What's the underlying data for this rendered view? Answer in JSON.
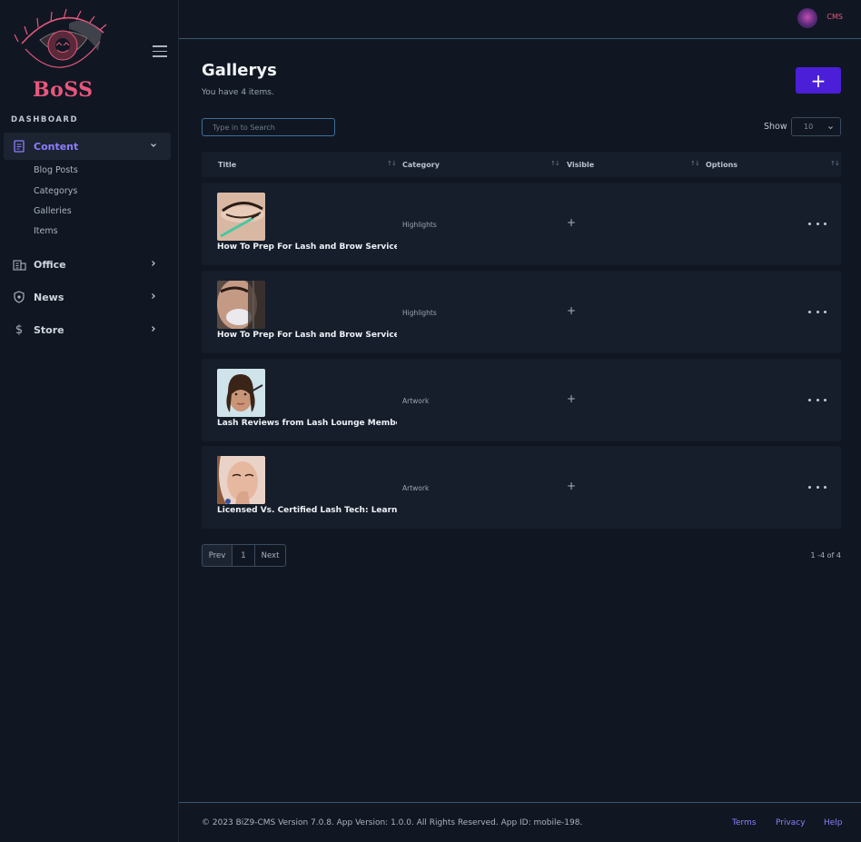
{
  "brand": {
    "logo_text": "BoSS",
    "accent": "#e8577e"
  },
  "topbar": {
    "cms_label": "CMS"
  },
  "sidebar": {
    "section_title": "DASHBOARD",
    "items": [
      {
        "label": "Content",
        "icon": "document-icon",
        "expanded": true,
        "subitems": [
          "Blog Posts",
          "Categorys",
          "Galleries",
          "Items"
        ]
      },
      {
        "label": "Office",
        "icon": "building-icon"
      },
      {
        "label": "News",
        "icon": "shield-icon"
      },
      {
        "label": "Store",
        "icon": "dollar-icon"
      }
    ]
  },
  "main": {
    "title": "Gallerys",
    "subtitle": "You have 4 items.",
    "add_button": "+",
    "search": {
      "placeholder": "Type in to Search",
      "value": ""
    },
    "show_label": "Show",
    "page_size": "10",
    "table": {
      "headers": [
        "Title",
        "Category",
        "Visible",
        "Options"
      ],
      "rows": [
        {
          "title": "How To Prep For Lash and Brow Services",
          "category": "Highlights",
          "visible": "+"
        },
        {
          "title": "How To Prep For Lash and Brow Services",
          "category": "Highlights",
          "visible": "+"
        },
        {
          "title": "Lash Reviews from Lash Lounge Members",
          "category": "Artwork",
          "visible": "+"
        },
        {
          "title": "Licensed Vs. Certified Lash Tech: Learn the",
          "category": "Artwork",
          "visible": "+"
        }
      ]
    },
    "pagination": {
      "prev": "Prev",
      "current": "1",
      "next": "Next",
      "range": "1 -4 of 4"
    }
  },
  "footer": {
    "copyright": "© 2023 BiZ9-CMS Version 7.0.8. App Version: 1.0.0. All Rights Reserved. App ID: mobile-198.",
    "links": [
      "Terms",
      "Privacy",
      "Help"
    ]
  },
  "colors": {
    "accent": "#4b1fd8",
    "link": "#8f7dff",
    "background": "#101722",
    "card": "#161e2b"
  }
}
